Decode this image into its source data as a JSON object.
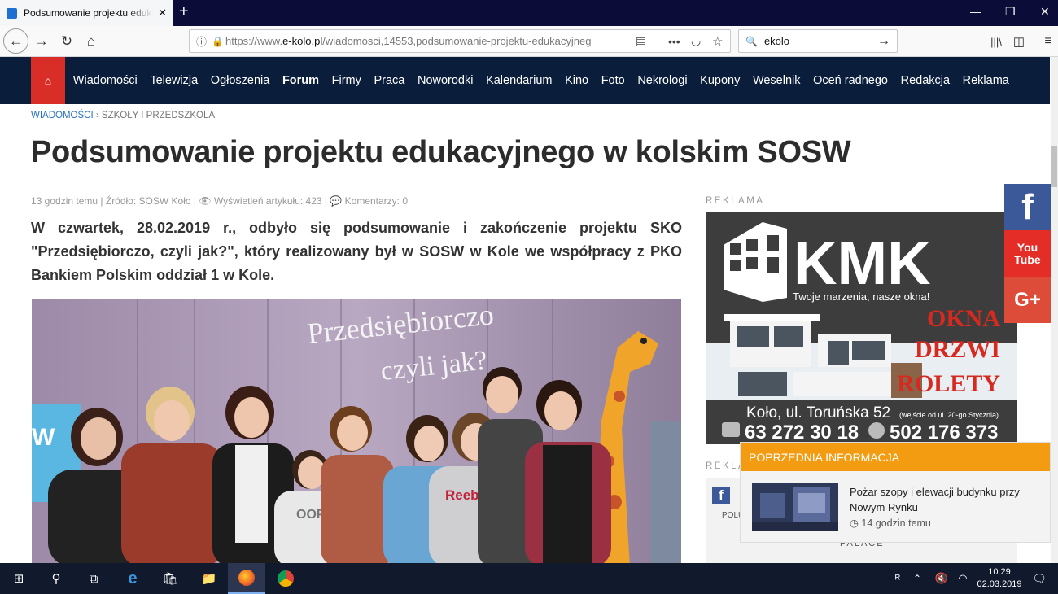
{
  "browser": {
    "tab_title": "Podsumowanie projektu edukacyjnego w kolskim SOSW",
    "url_prefix": "https://www.",
    "url_domain": "e-kolo.pl",
    "url_path": "/wiadomosci,14553,podsumowanie-projektu-edukacyjneg",
    "search_value": "ekolo",
    "icons": [
      "back-arrow-icon",
      "forward-arrow-icon",
      "reload-icon",
      "home-icon",
      "lock-icon",
      "reader-icon",
      "menu-dots-icon",
      "pocket-icon",
      "bookmark-star-icon",
      "search-icon",
      "library-icon",
      "sidebar-icon",
      "hamburger-icon"
    ]
  },
  "site": {
    "menu": [
      "Wiadomości",
      "Telewizja",
      "Ogłoszenia",
      "Forum",
      "Firmy",
      "Praca",
      "Noworodki",
      "Kalendarium",
      "Kino",
      "Foto",
      "Nekrologi",
      "Kupony",
      "Weselnik",
      "Oceń radnego",
      "Redakcja",
      "Reklama"
    ],
    "active_menu": "Forum",
    "colors": {
      "nav_bg": "#0a1e3c",
      "home_bg": "#d92d27",
      "accent_orange": "#f39c11",
      "link_blue": "#2a73c2"
    }
  },
  "article": {
    "breadcrumb_section": "WIADOMOŚCI",
    "breadcrumb_sep": " › ",
    "breadcrumb_sub": "SZKOŁY I PRZEDSZKOLA",
    "title": "Podsumowanie projektu edukacyjnego w kolskim SOSW",
    "meta_time": "13 godzin temu",
    "meta_source": "Źródło: SOSW Koło",
    "meta_views": "Wyświetleń artykułu: 423",
    "meta_comments": "Komentarzy: 0",
    "lead": "W czwartek, 28.02.2019 r., odbyło się podsumowanie i zakończenie projektu SKO \"Przedsiębiorczo, czyli jak?\", który realizowany był w SOSW w Kole we współpracy z PKO Bankiem Polskim oddział 1 w Kole.",
    "photo_banner_line1": "Przedsiębiorczo",
    "photo_banner_line2": "czyli jak?",
    "photo_shirt_text": "Reebok",
    "photo_shirt_text2": "OOPS!"
  },
  "sidebar": {
    "ad_label": "REKLAMA",
    "ad2_label": "REKLAMA",
    "kmk_brand": "KMK",
    "kmk_slogan": "Twoje marzenia, nasze okna!",
    "kmk_products": [
      "OKNA",
      "DRZWI",
      "ROLETY"
    ],
    "kmk_address": "Koło, ul. Toruńska 52",
    "kmk_address_note": "(wejście od ul. 20-go Stycznia)",
    "kmk_phone1": "63 272 30 18",
    "kmk_phone2": "502 176 373",
    "ad2_partial_text": "POLUI",
    "ad2_palace_text": "PALACE",
    "social": [
      {
        "name": "facebook",
        "label": "f",
        "color": "#3b5998"
      },
      {
        "name": "youtube",
        "label": "You Tube",
        "color": "#e52d27"
      },
      {
        "name": "google-plus",
        "label": "G+",
        "color": "#dd4b39"
      }
    ]
  },
  "previous": {
    "header": "POPRZEDNIA INFORMACJA",
    "title": "Pożar szopy i elewacji budynku przy Nowym Rynku",
    "time": "14 godzin temu"
  },
  "taskbar": {
    "time": "10:29",
    "date": "02.03.2019",
    "icons": [
      "windows-start-icon",
      "search-icon",
      "task-view-icon",
      "edge-icon",
      "store-icon",
      "file-explorer-icon",
      "firefox-icon",
      "chrome-icon",
      "people-icon",
      "chevron-up-icon",
      "volume-mute-icon",
      "wifi-icon",
      "notification-icon"
    ]
  }
}
